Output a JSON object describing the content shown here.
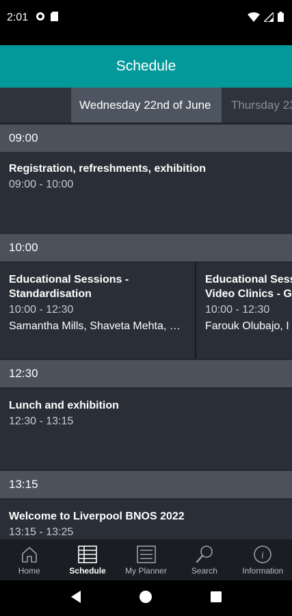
{
  "status_bar": {
    "time": "2:01",
    "left_icons": [
      "gear-icon",
      "sd-card-icon"
    ],
    "right_icons": [
      "wifi-icon",
      "signal-icon",
      "battery-icon"
    ]
  },
  "header": {
    "title": "Schedule"
  },
  "day_tabs": [
    {
      "label": "Wednesday 22nd of June",
      "active": true
    },
    {
      "label": "Thursday 23",
      "active": false
    }
  ],
  "schedule": {
    "slots": [
      {
        "time": "09:00",
        "sessions": [
          {
            "title": "Registration, refreshments, exhibition",
            "time": "09:00 - 10:00",
            "speakers": ""
          }
        ]
      },
      {
        "time": "10:00",
        "sessions": [
          {
            "title_line1": "Educational Sessions -",
            "title_line2": "Standardisation",
            "time": "10:00 - 12:30",
            "speakers": "Samantha Mills, Shaveta Mehta, …"
          },
          {
            "title_line1": "Educational Sess",
            "title_line2": "Video Clinics - G",
            "time": "10:00 - 12:30",
            "speakers": "Farouk Olubajo, I"
          }
        ]
      },
      {
        "time": "12:30",
        "sessions": [
          {
            "title": "Lunch and exhibition",
            "time": "12:30 - 13:15",
            "speakers": ""
          }
        ]
      },
      {
        "time": "13:15",
        "sessions": [
          {
            "title": "Welcome to Liverpool BNOS 2022",
            "time": "13:15 - 13:25",
            "speakers": ""
          }
        ]
      }
    ]
  },
  "bottom_nav": [
    {
      "label": "Home",
      "icon": "home-icon",
      "active": false
    },
    {
      "label": "Schedule",
      "icon": "schedule-grid-icon",
      "active": true
    },
    {
      "label": "My Planner",
      "icon": "planner-list-icon",
      "active": false
    },
    {
      "label": "Search",
      "icon": "search-icon",
      "active": false
    },
    {
      "label": "Information",
      "icon": "info-icon",
      "active": false
    }
  ],
  "system_nav": [
    "back-icon",
    "home-circle-icon",
    "recents-icon"
  ],
  "colors": {
    "accent": "#03999b",
    "background": "#22262d",
    "time_header": "#4b525c",
    "card": "#2a2f37"
  }
}
